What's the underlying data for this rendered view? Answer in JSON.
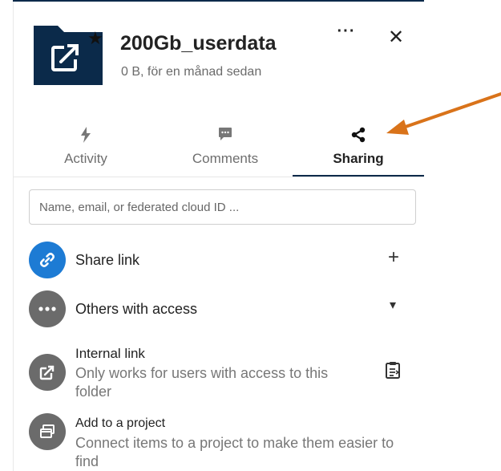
{
  "file": {
    "name": "200Gb_userdata",
    "meta": "0 B, för en månad sedan",
    "favorite_icon": "star-icon",
    "type_icon": "folder-share-icon"
  },
  "header": {
    "more_label": "···",
    "close_label": "✕"
  },
  "tabs": [
    {
      "label": "Activity",
      "icon": "lightning-icon",
      "active": false
    },
    {
      "label": "Comments",
      "icon": "comment-icon",
      "active": false
    },
    {
      "label": "Sharing",
      "icon": "share-icon",
      "active": true
    }
  ],
  "search": {
    "value": "",
    "placeholder": "Name, email, or federated cloud ID ..."
  },
  "share_link": {
    "label": "Share link",
    "action": "+"
  },
  "others": {
    "label": "Others with access",
    "action": "▾"
  },
  "internal_link": {
    "title": "Internal link",
    "subtitle": "Only works for users with access to this folder"
  },
  "project": {
    "title": "Add to a project",
    "subtitle": "Connect items to a project to make them easier to find"
  },
  "colors": {
    "accent": "#0b2a4a",
    "link_blue": "#1d7bd4",
    "annotation_arrow": "#d9731a"
  }
}
